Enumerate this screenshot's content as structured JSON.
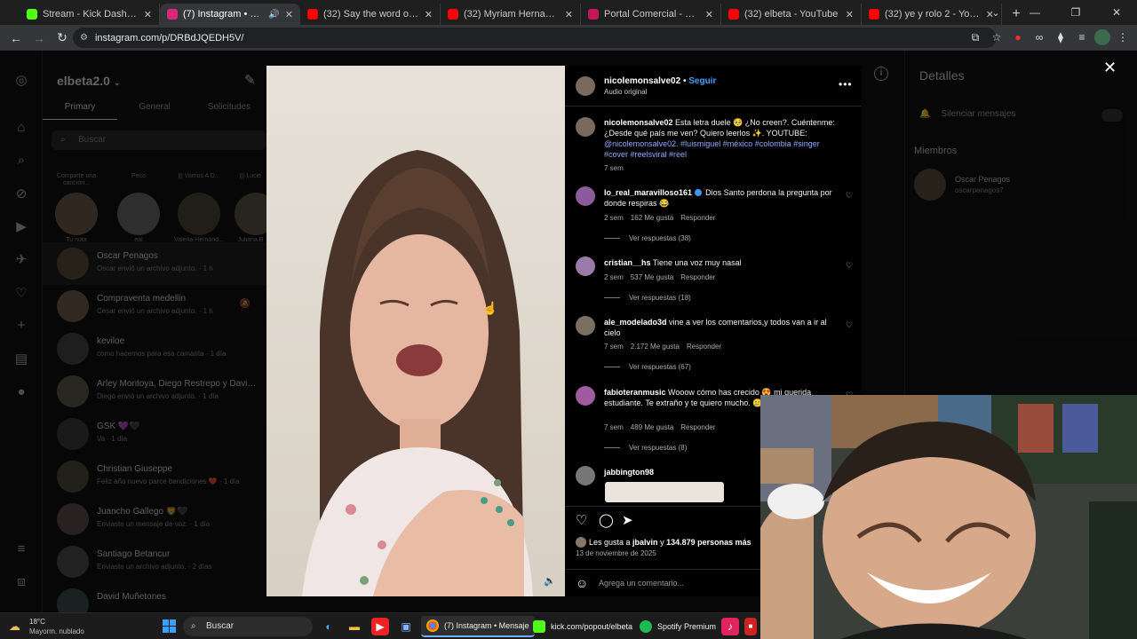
{
  "browser": {
    "tabs": [
      {
        "title": "Stream - Kick Dashboard",
        "color": "#53fc18",
        "active": false
      },
      {
        "title": "(7) Instagram • Mensajes",
        "color": "#d62976",
        "active": true
      },
      {
        "title": "(32) Say the word on beat. (Lev",
        "color": "#ff0000",
        "active": false
      },
      {
        "title": "(32) Myriam Hernandez - Herid",
        "color": "#ff0000",
        "active": false
      },
      {
        "title": "Portal Comercial - Loteria de M",
        "color": "#c2185b",
        "active": false
      },
      {
        "title": "(32) elbeta - YouTube",
        "color": "#ff0000",
        "active": false
      },
      {
        "title": "(32) ye y rolo 2 - YouTube",
        "color": "#ff0000",
        "active": false
      }
    ],
    "url": "instagram.com/p/DRBdJQEDH5V/"
  },
  "sidebar": {
    "account": "elbeta2.0",
    "tabs": [
      "Primary",
      "General",
      "Solicitudes"
    ],
    "search_placeholder": "Buscar",
    "notes": [
      {
        "bubble": "Comparte una canción...",
        "name": "Tu nota"
      },
      {
        "bubble": "Peco",
        "name": "eal"
      },
      {
        "bubble": "||| Vamos A D...",
        "name": "Valeria Hernánd..."
      },
      {
        "bubble": "||| Lucié",
        "name": "Juliana B"
      }
    ],
    "threads": [
      {
        "name": "Oscar Penagos",
        "preview": "Oscar envió un archivo adjunto. · 1 h"
      },
      {
        "name": "Compraventa medellin",
        "preview": "Cesar envió un archivo adjunto. · 1 h"
      },
      {
        "name": "keviloe",
        "preview": "como hacemos para esa camarita · 1 día"
      },
      {
        "name": "Arley Montoya, Diego Restrepo y David ...",
        "preview": "Diego envió un archivo adjunto. · 1 día"
      },
      {
        "name": "GSK 💜🖤",
        "preview": "Va · 1 día"
      },
      {
        "name": "Christian Giuseppe",
        "preview": "Feliz año nuevo parce bendiciones ❤️ · 1 día"
      },
      {
        "name": "Juancho Gallego 🦁🖤",
        "preview": "Enviaste un mensaje de voz. · 1 día"
      },
      {
        "name": "Santiago Betancur",
        "preview": "Enviaste un archivo adjunto. · 2 días"
      },
      {
        "name": "David Muñetones",
        "preview": ""
      }
    ]
  },
  "details": {
    "title": "Detalles",
    "silence": "Silenciar mensajes",
    "members_label": "Miembros",
    "member_name": "Oscar Penagos",
    "member_user": "oscarpenagos7"
  },
  "post": {
    "author": "nicolemonsalve02",
    "follow": "Seguir",
    "audio": "Audio original",
    "caption_user": "nicolemonsalve02",
    "caption_text": " Esta letra duele 🥺 ¿No creen?. Cuéntenme: ¿Desde qué país me ven? Quiero leerlos ✨. YOUTUBE: ",
    "caption_tags": "@nicolemonsalve02. #luismiguel #méxico #colombia #singer #cover #reelsviral #reel",
    "caption_time": "7 sem",
    "comments": [
      {
        "user": "lo_real_maravilloso161",
        "verified": true,
        "text": " Dios Santo perdona la pregunta por donde respiras 😂",
        "time": "2 sem",
        "likes": "162 Me gusta",
        "reply": "Responder",
        "replies": "Ver respuestas (38)"
      },
      {
        "user": "cristian__hs",
        "verified": false,
        "text": " Tiene una voz muy nasal",
        "time": "2 sem",
        "likes": "537 Me gusta",
        "reply": "Responder",
        "replies": "Ver respuestas (18)"
      },
      {
        "user": "ale_modelado3d",
        "verified": false,
        "text": " vine a ver los comentarios,y todos van a ir al cielo",
        "time": "7 sem",
        "likes": "2.172 Me gusta",
        "reply": "Responder",
        "replies": "Ver respuestas (67)"
      },
      {
        "user": "fabioteranmusic",
        "verified": false,
        "text": " Wooow cómo has crecido 😍 mi querida estudiante. Te extraño y te quiero mucho. 🥲🙏",
        "time": "7 sem",
        "likes": "489 Me gusta",
        "reply": "Responder",
        "replies": "Ver respuestas (8)"
      },
      {
        "user": "jabbington98",
        "verified": false,
        "text": "",
        "time": "",
        "likes": "",
        "reply": "",
        "replies": ""
      }
    ],
    "likes_prefix": "Les gusta a ",
    "likes_user": "jbalvin",
    "likes_mid": " y ",
    "likes_count": "134.879 personas más",
    "date": "13 de noviembre de 2025",
    "comment_placeholder": "Agrega un comentario..."
  },
  "taskbar": {
    "temp": "18°C",
    "weather": "Mayorm. nublado",
    "search": "Buscar",
    "tasks": [
      "(7) Instagram • Mensaje",
      "kick.com/popout/elbeta",
      "Spotify Premium"
    ]
  }
}
